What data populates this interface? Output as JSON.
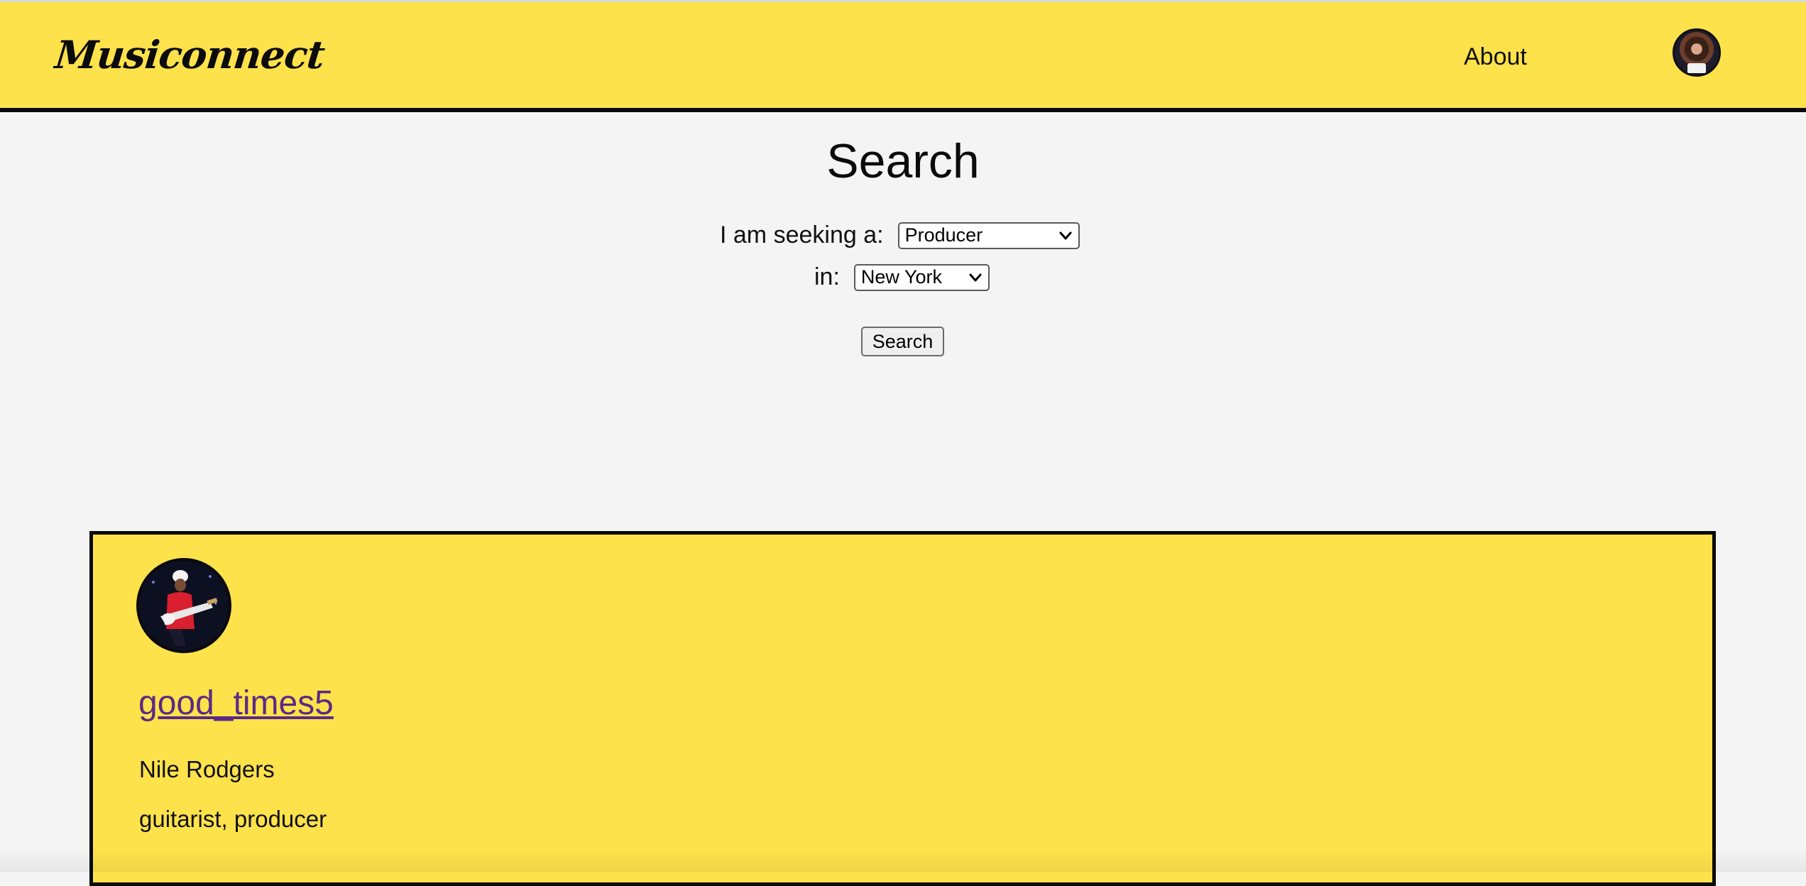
{
  "nav": {
    "logo": "Musiconnect",
    "about_label": "About",
    "avatar_icon": "user-avatar-icon"
  },
  "search": {
    "title": "Search",
    "seeking_label": "I am seeking a:",
    "seeking_selected": "Producer",
    "location_label": "in:",
    "location_selected": "New York",
    "button_label": "Search"
  },
  "results": [
    {
      "username": "good_times5",
      "full_name": "Nile Rodgers",
      "roles": "guitarist, producer"
    }
  ],
  "colors": {
    "header_bg": "#fee24b",
    "card_bg": "#fee24b",
    "page_bg": "#f4f4f4",
    "link": "#5a2a86",
    "border": "#0a0a0a"
  }
}
